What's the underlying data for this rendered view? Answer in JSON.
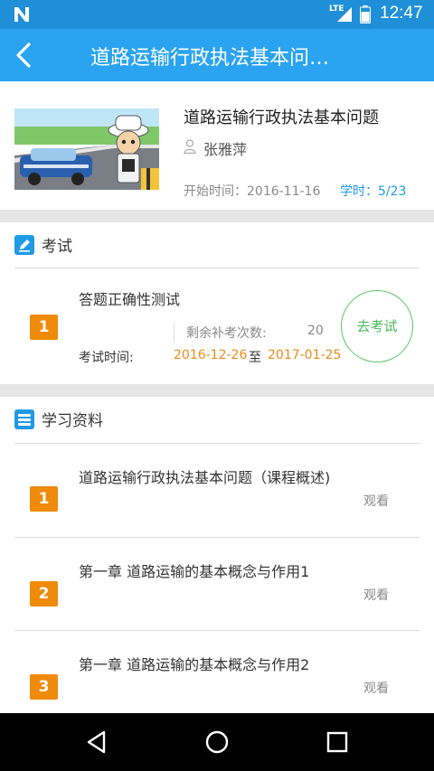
{
  "status_bar": {
    "time": "12:47",
    "network": "LTE",
    "icons": [
      "n-logo-icon",
      "signal-icon",
      "battery-icon"
    ]
  },
  "app_bar": {
    "title": "道路运输行政执法基本问…",
    "back_icon": "back-arrow-icon"
  },
  "course": {
    "title": "道路运输行政执法基本问题",
    "teacher": "张雅萍",
    "start_time": "开始时间：2016-11-16",
    "hours": "学时：5/23"
  },
  "exam_section": {
    "label": "考试",
    "icon": "edit-icon",
    "items": [
      {
        "index": "1",
        "name": "答题正确性测试",
        "retake_label": "剩余补考次数:",
        "retake_count": "20",
        "time_label": "考试时间:",
        "start": "2016-12-26",
        "to": "至",
        "end": "2017-01-25",
        "action": "去考试"
      }
    ]
  },
  "materials_section": {
    "label": "学习资料",
    "icon": "book-stack-icon",
    "items": [
      {
        "index": "1",
        "title": "道路运输行政执法基本问题（课程概述)",
        "action": "观看"
      },
      {
        "index": "2",
        "title": "第一章 道路运输的基本概念与作用1",
        "action": "观看"
      },
      {
        "index": "3",
        "title": "第一章 道路运输的基本概念与作用2",
        "action": "观看"
      }
    ]
  },
  "colors": {
    "status_bar": "#1f8fd8",
    "app_bar": "#2aa3f0",
    "badge": "#f08a0a",
    "date_orange": "#ef8a1c",
    "accent_blue": "#1f9ae5",
    "go_exam_green": "#49b85a"
  }
}
